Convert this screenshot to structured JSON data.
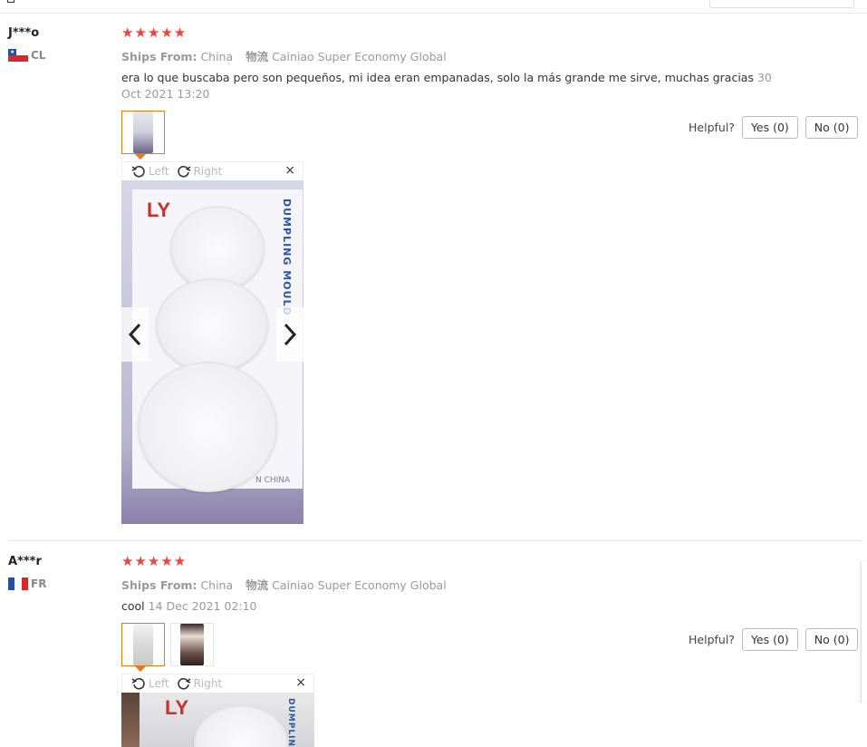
{
  "reviews": [
    {
      "user": "J***o",
      "country": "CL",
      "stars": "★★★★★",
      "ships_from_label": "Ships From:",
      "ships_from_value": "China",
      "logistics_label": "物流",
      "logistics_value": "Cainiao Super Economy Global",
      "text": "era lo que buscaba pero son pequeños, mi idea eran empanadas, solo la más grande me sirve, muchas gracias",
      "date": "30 Oct 2021 13:20",
      "helpful_label": "Helpful?",
      "yes_label": "Yes (0)",
      "no_label": "No (0)",
      "viewer": {
        "left": "Left",
        "right": "Right",
        "close": "×",
        "brand": "LY",
        "product_text": "DUMPLING MOULD",
        "made_text": "N CHINA"
      }
    },
    {
      "user": "A***r",
      "country": "FR",
      "stars": "★★★★★",
      "ships_from_label": "Ships From:",
      "ships_from_value": "China",
      "logistics_label": "物流",
      "logistics_value": "Cainiao Super Economy Global",
      "text": "cool",
      "date": "14 Dec 2021 02:10",
      "helpful_label": "Helpful?",
      "yes_label": "Yes (0)",
      "no_label": "No (0)",
      "viewer": {
        "left": "Left",
        "right": "Right",
        "close": "×",
        "brand": "LY",
        "product_text": "DUMPLING"
      }
    }
  ],
  "colors": {
    "star": "#f0443b",
    "accent": "#e07c1c"
  }
}
